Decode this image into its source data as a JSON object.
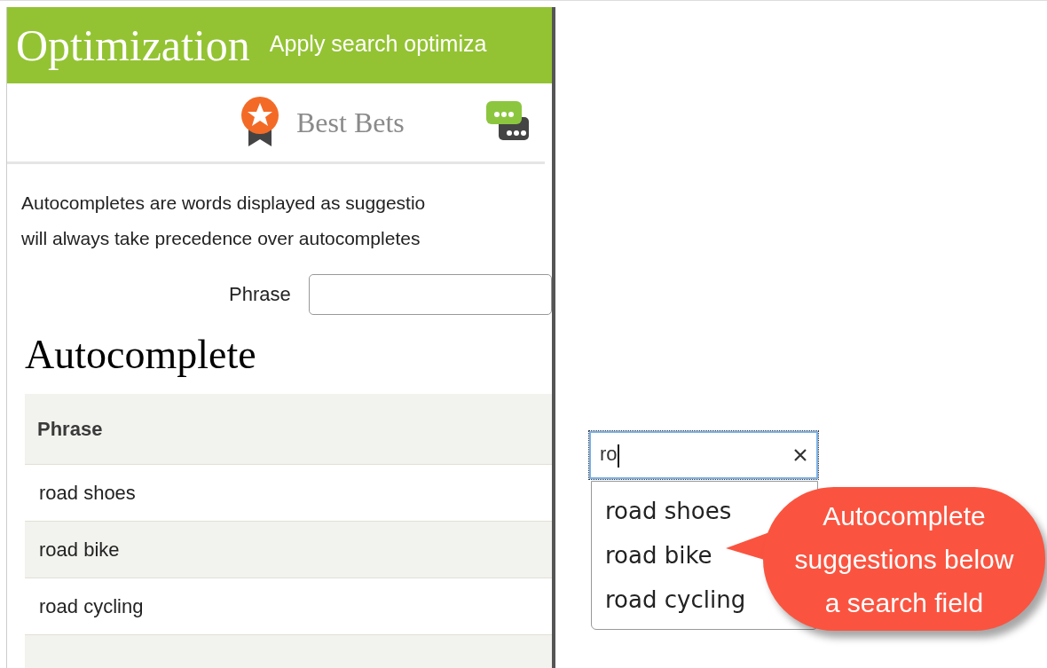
{
  "header": {
    "title": "Optimization",
    "subtitle": "Apply search optimiza"
  },
  "tabs": [
    {
      "kind": "ribbon",
      "label": "Best Bets"
    },
    {
      "kind": "chat"
    }
  ],
  "description": "Autocompletes are words displayed as suggestio\nwill always take precedence over autocompletes",
  "phrase_field": {
    "label": "Phrase"
  },
  "section_title": "Autocomplete",
  "table": {
    "columns": [
      "Phrase"
    ],
    "rows": [
      "road shoes",
      "road bike",
      "road cycling"
    ]
  },
  "search": {
    "value": "ro",
    "focused": true
  },
  "suggestions": [
    "road shoes",
    "road bike",
    "road cycling"
  ],
  "callout": "Autocomplete\nsuggestions below\na search field"
}
